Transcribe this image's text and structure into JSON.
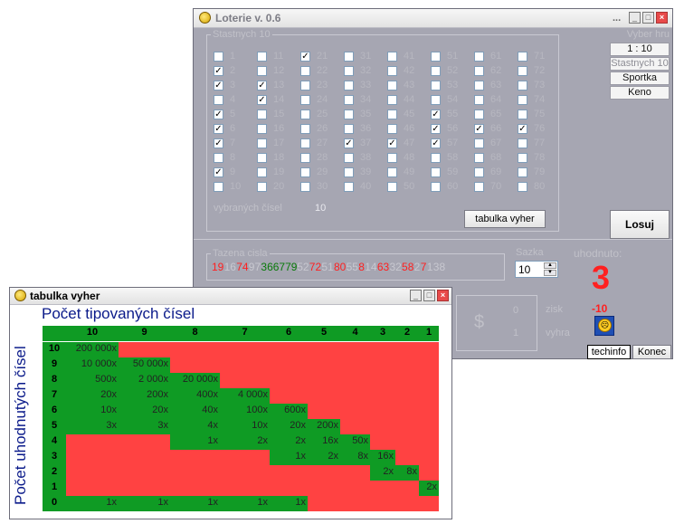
{
  "main_window": {
    "title": "Loterie v. 0.6",
    "title_dots": "...",
    "group_lucky_label": "Stastnych 10",
    "numbers": [
      [
        1,
        11,
        21,
        31,
        41,
        51,
        61,
        71
      ],
      [
        2,
        12,
        22,
        32,
        42,
        52,
        62,
        72
      ],
      [
        3,
        13,
        23,
        33,
        43,
        53,
        63,
        73
      ],
      [
        4,
        14,
        24,
        34,
        44,
        54,
        64,
        74
      ],
      [
        5,
        15,
        25,
        35,
        45,
        55,
        65,
        75
      ],
      [
        6,
        16,
        26,
        36,
        46,
        56,
        66,
        76
      ],
      [
        7,
        17,
        27,
        37,
        47,
        57,
        67,
        77
      ],
      [
        8,
        18,
        28,
        38,
        48,
        58,
        68,
        78
      ],
      [
        9,
        19,
        29,
        39,
        49,
        59,
        69,
        79
      ],
      [
        10,
        20,
        30,
        40,
        50,
        60,
        70,
        80
      ]
    ],
    "checked": [
      2,
      3,
      5,
      6,
      7,
      9,
      13,
      14,
      21,
      37,
      47,
      55,
      56,
      57,
      66,
      76
    ],
    "selected_label": "vybraných čísel",
    "selected_count": "10",
    "prize_table_button": "tabulka vyher",
    "game_choice_label": "Vyber hru",
    "game_buttons": [
      "1 : 10",
      "Stastnych 10",
      "Sportka",
      "Keno"
    ],
    "draw_button": "Losuj",
    "drawn_label": "Tazena cisla",
    "drawn_numbers": [
      {
        "text": "19",
        "color": "red"
      },
      {
        "text": "16",
        "color": "grey"
      },
      {
        "text": "74",
        "color": "red"
      },
      {
        "text": "97",
        "color": "grey"
      },
      {
        "text": "366779",
        "color": "green"
      },
      {
        "text": "52",
        "color": "grey"
      },
      {
        "text": "72",
        "color": "red"
      },
      {
        "text": "51",
        "color": "grey"
      },
      {
        "text": "80",
        "color": "red"
      },
      {
        "text": "55",
        "color": "grey"
      },
      {
        "text": "8",
        "color": "red"
      },
      {
        "text": "14",
        "color": "grey"
      },
      {
        "text": "63",
        "color": "red"
      },
      {
        "text": "32",
        "color": "grey"
      },
      {
        "text": "58",
        "color": "red"
      },
      {
        "text": "2",
        "color": "grey"
      },
      {
        "text": "7",
        "color": "red"
      },
      {
        "text": "1",
        "color": "grey"
      },
      {
        "text": "38",
        "color": "grey"
      }
    ],
    "bet_label": "Sazka",
    "bet_value": "10",
    "guessed_label": "uhodnuto:",
    "guessed_value": "3",
    "profit_label": "zisk",
    "profit_value": "-10",
    "win_label": "vyhra",
    "dollar": "$",
    "money_values": [
      "0",
      "1"
    ],
    "techinfo_button": "techinfo",
    "end_button": "Konec",
    "colors": {
      "red": "#ff2020",
      "green": "#0a7a0a",
      "window_bg": "#a6a6b2"
    }
  },
  "table_window": {
    "title": "tabulka vyher",
    "top_title": "Počet tipovaných čísel",
    "side_title": "Počet uhodnutých čísel",
    "columns": [
      "10",
      "9",
      "8",
      "7",
      "6",
      "5",
      "4",
      "3",
      "2",
      "1"
    ],
    "rows": [
      "10",
      "9",
      "8",
      "7",
      "6",
      "5",
      "4",
      "3",
      "2",
      "1",
      "0"
    ],
    "cells": [
      [
        "200 000x",
        "",
        "",
        "",
        "",
        "",
        "",
        "",
        "",
        ""
      ],
      [
        "10 000x",
        "50 000x",
        "",
        "",
        "",
        "",
        "",
        "",
        "",
        ""
      ],
      [
        "500x",
        "2 000x",
        "20 000x",
        "",
        "",
        "",
        "",
        "",
        "",
        ""
      ],
      [
        "20x",
        "200x",
        "400x",
        "4 000x",
        "",
        "",
        "",
        "",
        "",
        ""
      ],
      [
        "10x",
        "20x",
        "40x",
        "100x",
        "600x",
        "",
        "",
        "",
        "",
        ""
      ],
      [
        "3x",
        "3x",
        "4x",
        "10x",
        "20x",
        "200x",
        "",
        "",
        "",
        ""
      ],
      [
        "",
        "",
        "1x",
        "2x",
        "2x",
        "16x",
        "50x",
        "",
        "",
        ""
      ],
      [
        "",
        "",
        "",
        "",
        "1x",
        "2x",
        "8x",
        "16x",
        "",
        ""
      ],
      [
        "",
        "",
        "",
        "",
        "",
        "",
        "",
        "2x",
        "8x",
        ""
      ],
      [
        "",
        "",
        "",
        "",
        "",
        "",
        "",
        "",
        "",
        "2x"
      ],
      [
        "1x",
        "1x",
        "1x",
        "1x",
        "1x",
        "",
        "",
        "",
        "",
        ""
      ]
    ],
    "green_mask": [
      [
        1,
        0,
        0,
        0,
        0,
        0,
        0,
        0,
        0,
        0
      ],
      [
        1,
        1,
        0,
        0,
        0,
        0,
        0,
        0,
        0,
        0
      ],
      [
        1,
        1,
        1,
        0,
        0,
        0,
        0,
        0,
        0,
        0
      ],
      [
        1,
        1,
        1,
        1,
        0,
        0,
        0,
        0,
        0,
        0
      ],
      [
        1,
        1,
        1,
        1,
        1,
        0,
        0,
        0,
        0,
        0
      ],
      [
        1,
        1,
        1,
        1,
        1,
        1,
        0,
        0,
        0,
        0
      ],
      [
        0,
        0,
        1,
        1,
        1,
        1,
        1,
        0,
        0,
        0
      ],
      [
        0,
        0,
        0,
        0,
        1,
        1,
        1,
        1,
        0,
        0
      ],
      [
        0,
        0,
        0,
        0,
        0,
        0,
        0,
        1,
        1,
        0
      ],
      [
        0,
        0,
        0,
        0,
        0,
        0,
        0,
        0,
        0,
        1
      ],
      [
        1,
        1,
        1,
        1,
        1,
        0,
        0,
        0,
        0,
        0
      ]
    ]
  }
}
